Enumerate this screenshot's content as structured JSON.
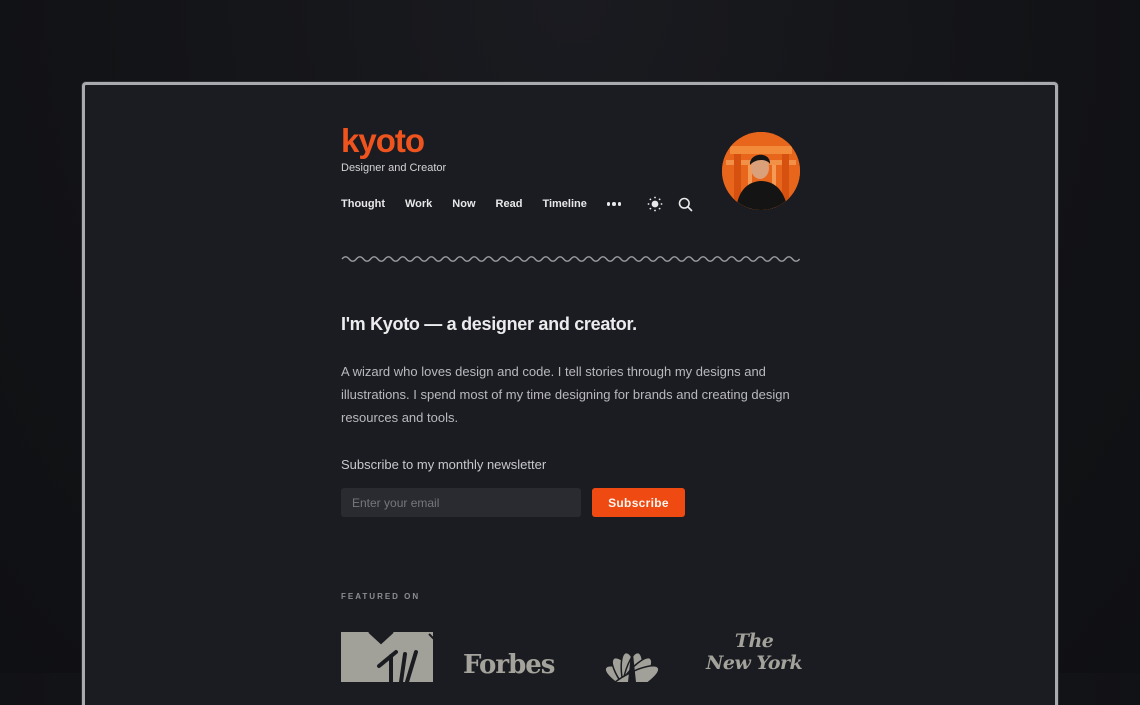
{
  "site": {
    "logo": "kyoto",
    "tagline": "Designer and Creator",
    "accent_color": "#f0541e"
  },
  "nav": {
    "items": [
      {
        "label": "Thought"
      },
      {
        "label": "Work"
      },
      {
        "label": "Now"
      },
      {
        "label": "Read"
      },
      {
        "label": "Timeline"
      }
    ],
    "more_icon": "ellipsis-icon",
    "theme_icon": "sun-icon",
    "search_icon": "search-icon"
  },
  "avatar": {
    "alt": "Portrait of Kyoto in front of orange torii gates"
  },
  "intro": {
    "headline": "I'm Kyoto — a designer and creator.",
    "bio": "A wizard who loves design and code. I tell stories through my designs and illustrations. I spend most of my time designing for brands and creating design resources and tools."
  },
  "newsletter": {
    "label": "Subscribe to my monthly newsletter",
    "email_value": "",
    "email_placeholder": "Enter your email",
    "button_label": "Subscribe",
    "button_color": "#ee4a12"
  },
  "featured": {
    "label": "FEATURED ON",
    "brands": [
      {
        "name": "MTV",
        "icon": "mtv-logo"
      },
      {
        "name": "Forbes",
        "icon": "forbes-logo"
      },
      {
        "name": "NBC",
        "icon": "nbc-peacock-logo"
      },
      {
        "name": "The New York",
        "line1": "The",
        "line2": "New York",
        "icon": "nyt-logo"
      }
    ]
  }
}
